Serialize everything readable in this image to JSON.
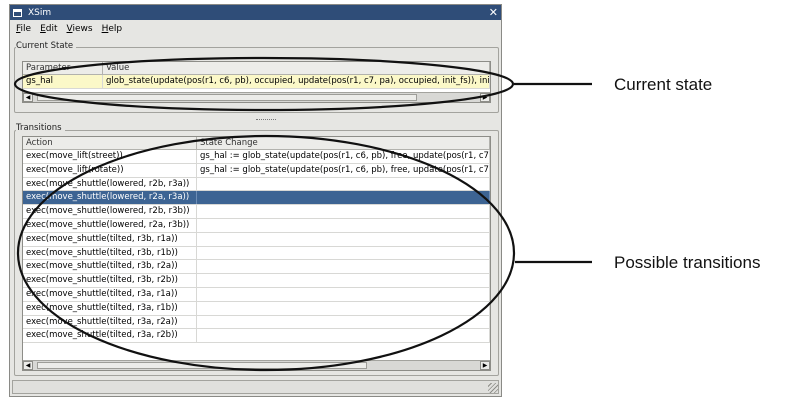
{
  "window": {
    "title": "XSim",
    "close_glyph": "✕",
    "menu": [
      "File",
      "Edit",
      "Views",
      "Help"
    ]
  },
  "current_state": {
    "group_label": "Current State",
    "columns": [
      "Parameter",
      "Value"
    ],
    "rows": [
      {
        "parameter": "gs_hal",
        "value": "glob_state(update(pos(r1, c6, pb), occupied, update(pos(r1, c7, pa), occupied, init_fs)), init_"
      }
    ]
  },
  "transitions": {
    "group_label": "Transitions",
    "columns": [
      "Action",
      "State Change"
    ],
    "selected_index": 3,
    "rows": [
      {
        "action": "exec(move_lift(street))",
        "change": "gs_hal := glob_state(update(pos(r1, c6, pb), free, update(pos(r1, c7,"
      },
      {
        "action": "exec(move_lift(rotate))",
        "change": "gs_hal := glob_state(update(pos(r1, c6, pb), free, update(pos(r1, c7,"
      },
      {
        "action": "exec(move_shuttle(lowered, r2b, r3a))",
        "change": ""
      },
      {
        "action": "exec(move_shuttle(lowered, r2a, r3a))",
        "change": ""
      },
      {
        "action": "exec(move_shuttle(lowered, r2b, r3b))",
        "change": ""
      },
      {
        "action": "exec(move_shuttle(lowered, r2a, r3b))",
        "change": ""
      },
      {
        "action": "exec(move_shuttle(tilted, r3b, r1a))",
        "change": ""
      },
      {
        "action": "exec(move_shuttle(tilted, r3b, r1b))",
        "change": ""
      },
      {
        "action": "exec(move_shuttle(tilted, r3b, r2a))",
        "change": ""
      },
      {
        "action": "exec(move_shuttle(tilted, r3b, r2b))",
        "change": ""
      },
      {
        "action": "exec(move_shuttle(tilted, r3a, r1a))",
        "change": ""
      },
      {
        "action": "exec(move_shuttle(tilted, r3a, r1b))",
        "change": ""
      },
      {
        "action": "exec(move_shuttle(tilted, r3a, r2a))",
        "change": ""
      },
      {
        "action": "exec(move_shuttle(tilted, r3a, r2b))",
        "change": ""
      }
    ]
  },
  "annotations": {
    "current_state": "Current state",
    "possible_transitions": "Possible transitions"
  }
}
